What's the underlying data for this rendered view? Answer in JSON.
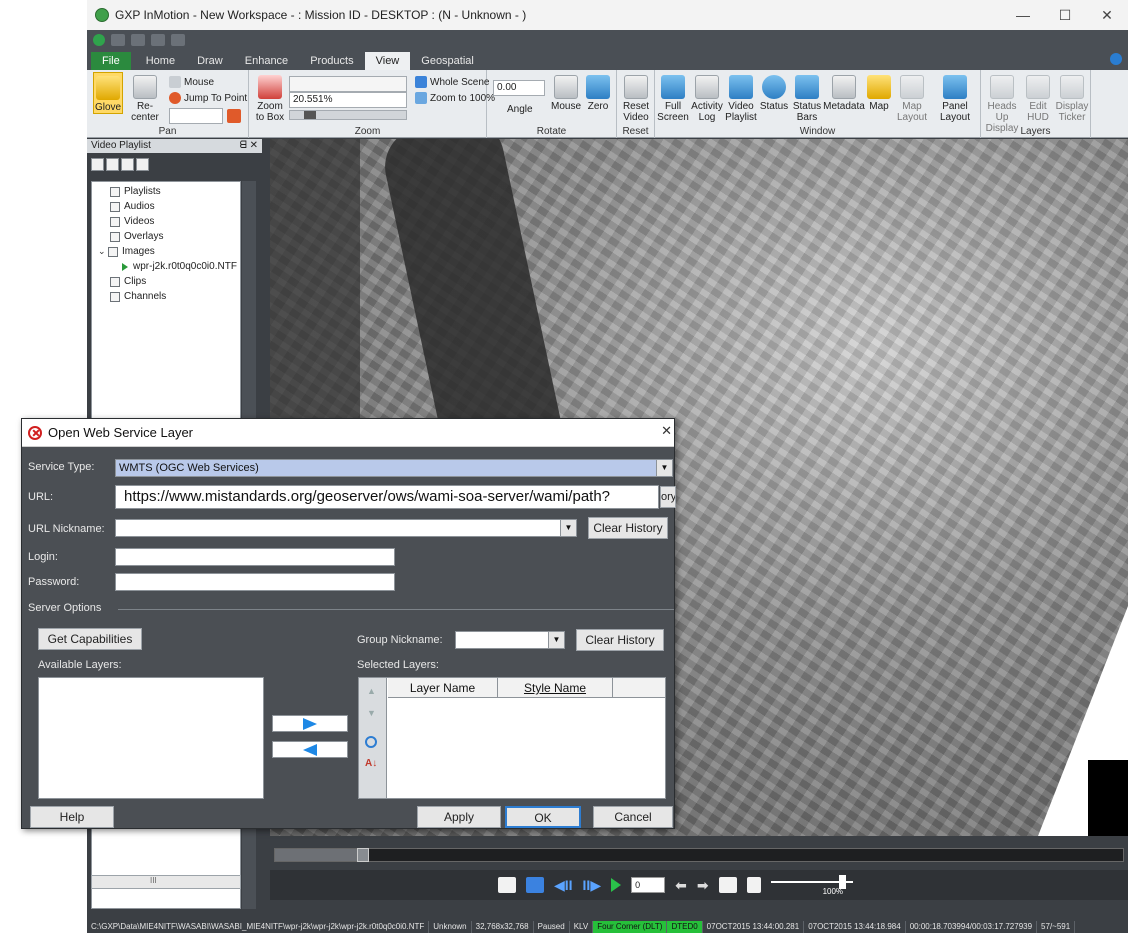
{
  "window": {
    "title": "GXP InMotion - New Workspace - : Mission ID - DESKTOP : (N - Unknown - )",
    "minimize": "—",
    "maximize": "☐",
    "close": "✕"
  },
  "ribbon": {
    "tabs": [
      "File",
      "Home",
      "Draw",
      "Enhance",
      "Products",
      "View",
      "Geospatial"
    ],
    "active_tab": "View",
    "pan": {
      "group_label": "Pan",
      "glove": "Glove",
      "recenter": "Re-center",
      "mouse": "Mouse",
      "jump_to_point": "Jump To Point"
    },
    "zoom": {
      "group_label": "Zoom",
      "zoom_to_box_line1": "Zoom",
      "zoom_to_box_line2": "to Box",
      "zoom_value": "20.551%",
      "whole_scene": "Whole Scene",
      "zoom_to_100": "Zoom to 100%"
    },
    "rotate": {
      "group_label": "Rotate",
      "angle_value": "0.00",
      "angle_label": "Angle",
      "mouse": "Mouse",
      "zero": "Zero"
    },
    "reset": {
      "group_label": "Reset",
      "reset_video_line1": "Reset",
      "reset_video_line2": "Video",
      "reset_video_line3": "Reset"
    },
    "window_group": {
      "group_label": "Window",
      "full_screen_1": "Full",
      "full_screen_2": "Screen",
      "activity_log_1": "Activity",
      "activity_log_2": "Log",
      "video_playlist_1": "Video",
      "video_playlist_2": "Playlist",
      "status": "Status",
      "status_bars_1": "Status",
      "status_bars_2": "Bars",
      "metadata": "Metadata",
      "map": "Map",
      "map_layout_1": "Map",
      "map_layout_2": "Layout",
      "panel_layout_1": "Panel",
      "panel_layout_2": "Layout"
    },
    "layers": {
      "group_label": "Layers",
      "heads_up_display_1": "Heads Up",
      "heads_up_display_2": "Display",
      "edit_hud_1": "Edit",
      "edit_hud_2": "HUD",
      "display_ticker_1": "Display",
      "display_ticker_2": "Ticker"
    }
  },
  "playlist": {
    "title": "Video Playlist",
    "pin": "ᗺ ✕",
    "items": [
      {
        "label": "Playlists"
      },
      {
        "label": "Audios"
      },
      {
        "label": "Videos"
      },
      {
        "label": "Overlays"
      },
      {
        "label": "Images"
      },
      {
        "label": "wpr-j2k.r0t0q0c0i0.NTF"
      },
      {
        "label": "Clips"
      },
      {
        "label": "Channels"
      }
    ],
    "scroll_mid": "III"
  },
  "player": {
    "frame_value": "0",
    "volume_label": "100%",
    "volume_level": 0.83
  },
  "statusbar": {
    "path": "C:\\GXP\\Data\\MIE4NITF\\WASABI\\WASABI_MIE4NITF\\wpr-j2k\\wpr-j2k\\wpr-j2k.r0t0q0c0i0.NTF",
    "unknown": "Unknown",
    "dims": "32,768x32,768",
    "state": "Paused",
    "klv": "KLV",
    "corner": "Four Corner (DLT)",
    "dted": "DTED0",
    "time1": "07OCT2015 13:44:00.281",
    "time2": "07OCT2015 13:44:18.984",
    "elapsed": "00:00:18.703994/00:03:17.727939",
    "frames": "57/~591"
  },
  "dialog": {
    "title": "Open Web Service Layer",
    "close": "✕",
    "service_type_label": "Service Type:",
    "service_type_value": "WMTS (OGC Web Services)",
    "url_label": "URL:",
    "url_value": "https://www.mistandards.org/geoserver/ows/wami-soa-server/wami/path?",
    "url_history_fragment": "ory",
    "url_nickname_label": "URL Nickname:",
    "clear_history": "Clear History",
    "login_label": "Login:",
    "password_label": "Password:",
    "server_options_label": "Server Options",
    "get_capabilities": "Get Capabilities",
    "group_nickname_label": "Group Nickname:",
    "group_clear_history": "Clear History",
    "available_layers_label": "Available Layers:",
    "selected_layers_label": "Selected Layers:",
    "col_layer_name": "Layer Name",
    "col_style_name": "Style Name",
    "help": "Help",
    "apply": "Apply",
    "ok": "OK",
    "cancel": "Cancel"
  },
  "colors": {
    "accent": "#2b8a3e",
    "dialog_bg": "#4b4f54",
    "selection": "#b9c9ea",
    "focus_border": "#2d7dd2"
  }
}
